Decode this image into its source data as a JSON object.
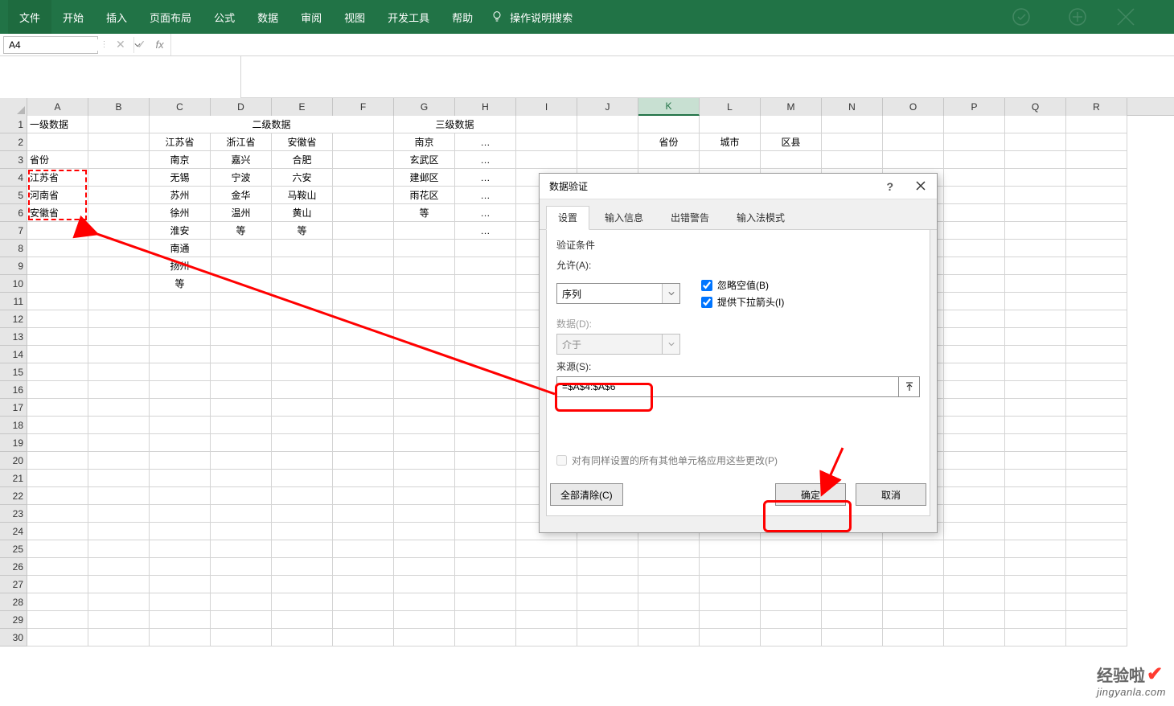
{
  "ribbon": {
    "tabs": [
      "文件",
      "开始",
      "插入",
      "页面布局",
      "公式",
      "数据",
      "审阅",
      "视图",
      "开发工具",
      "帮助"
    ],
    "tellme": "操作说明搜索"
  },
  "namebox": "A4",
  "columns": [
    "A",
    "B",
    "C",
    "D",
    "E",
    "F",
    "G",
    "H",
    "I",
    "J",
    "K",
    "L",
    "M",
    "N",
    "O",
    "P",
    "Q",
    "R"
  ],
  "selectedCol": "K",
  "rows": 30,
  "data": {
    "r1": {
      "A": "一级数据",
      "CDEF_merge": "二级数据",
      "GH_merge": "三级数据"
    },
    "r2": {
      "C": "江苏省",
      "D": "浙江省",
      "E": "安徽省",
      "G": "南京",
      "H": "…",
      "K": "省份",
      "L": "城市",
      "M": "区县"
    },
    "r3": {
      "A": "省份",
      "C": "南京",
      "D": "嘉兴",
      "E": "合肥",
      "G": "玄武区",
      "H": "…"
    },
    "r4": {
      "A": "江苏省",
      "C": "无锡",
      "D": "宁波",
      "E": "六安",
      "G": "建邺区",
      "H": "…"
    },
    "r5": {
      "A": "河南省",
      "C": "苏州",
      "D": "金华",
      "E": "马鞍山",
      "G": "雨花区",
      "H": "…"
    },
    "r6": {
      "A": "安徽省",
      "C": "徐州",
      "D": "温州",
      "E": "黄山",
      "G": "等",
      "H": "…"
    },
    "r7": {
      "C": "淮安",
      "D": "等",
      "E": "等",
      "H": "…"
    },
    "r8": {
      "C": "南通"
    },
    "r9": {
      "C": "扬州"
    },
    "r10": {
      "C": "等"
    }
  },
  "dialog": {
    "title": "数据验证",
    "help": "?",
    "tabs": [
      "设置",
      "输入信息",
      "出错警告",
      "输入法模式"
    ],
    "activeTab": 0,
    "section": "验证条件",
    "allow_label": "允许(A):",
    "allow_value": "序列",
    "ignore_blank": "忽略空值(B)",
    "dropdown": "提供下拉箭头(I)",
    "data_label": "数据(D):",
    "data_value": "介于",
    "source_label": "来源(S):",
    "source_value": "=$A$4:$A$6",
    "apply_all": "对有同样设置的所有其他单元格应用这些更改(P)",
    "clear": "全部清除(C)",
    "ok": "确定",
    "cancel": "取消"
  },
  "watermark": {
    "t1": "经验啦",
    "t2": "jingyanla.com"
  }
}
